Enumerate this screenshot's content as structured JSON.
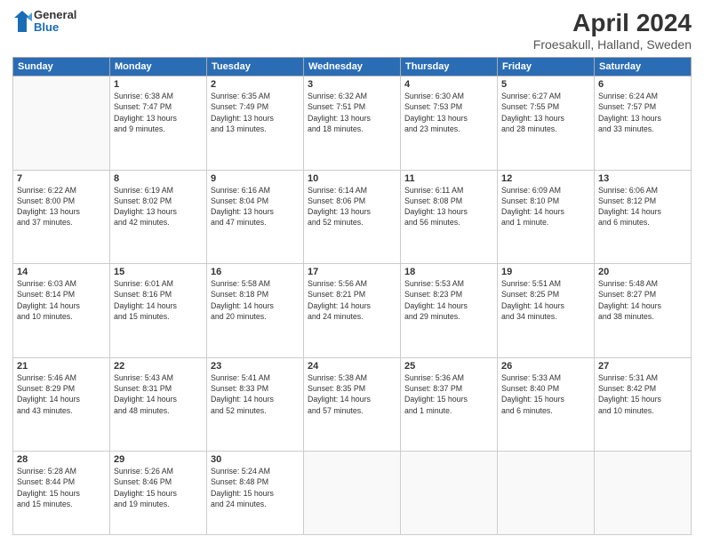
{
  "header": {
    "logo_general": "General",
    "logo_blue": "Blue",
    "title": "April 2024",
    "subtitle": "Froesakull, Halland, Sweden"
  },
  "days_of_week": [
    "Sunday",
    "Monday",
    "Tuesday",
    "Wednesday",
    "Thursday",
    "Friday",
    "Saturday"
  ],
  "weeks": [
    [
      {
        "day": "",
        "info": ""
      },
      {
        "day": "1",
        "info": "Sunrise: 6:38 AM\nSunset: 7:47 PM\nDaylight: 13 hours\nand 9 minutes."
      },
      {
        "day": "2",
        "info": "Sunrise: 6:35 AM\nSunset: 7:49 PM\nDaylight: 13 hours\nand 13 minutes."
      },
      {
        "day": "3",
        "info": "Sunrise: 6:32 AM\nSunset: 7:51 PM\nDaylight: 13 hours\nand 18 minutes."
      },
      {
        "day": "4",
        "info": "Sunrise: 6:30 AM\nSunset: 7:53 PM\nDaylight: 13 hours\nand 23 minutes."
      },
      {
        "day": "5",
        "info": "Sunrise: 6:27 AM\nSunset: 7:55 PM\nDaylight: 13 hours\nand 28 minutes."
      },
      {
        "day": "6",
        "info": "Sunrise: 6:24 AM\nSunset: 7:57 PM\nDaylight: 13 hours\nand 33 minutes."
      }
    ],
    [
      {
        "day": "7",
        "info": "Sunrise: 6:22 AM\nSunset: 8:00 PM\nDaylight: 13 hours\nand 37 minutes."
      },
      {
        "day": "8",
        "info": "Sunrise: 6:19 AM\nSunset: 8:02 PM\nDaylight: 13 hours\nand 42 minutes."
      },
      {
        "day": "9",
        "info": "Sunrise: 6:16 AM\nSunset: 8:04 PM\nDaylight: 13 hours\nand 47 minutes."
      },
      {
        "day": "10",
        "info": "Sunrise: 6:14 AM\nSunset: 8:06 PM\nDaylight: 13 hours\nand 52 minutes."
      },
      {
        "day": "11",
        "info": "Sunrise: 6:11 AM\nSunset: 8:08 PM\nDaylight: 13 hours\nand 56 minutes."
      },
      {
        "day": "12",
        "info": "Sunrise: 6:09 AM\nSunset: 8:10 PM\nDaylight: 14 hours\nand 1 minute."
      },
      {
        "day": "13",
        "info": "Sunrise: 6:06 AM\nSunset: 8:12 PM\nDaylight: 14 hours\nand 6 minutes."
      }
    ],
    [
      {
        "day": "14",
        "info": "Sunrise: 6:03 AM\nSunset: 8:14 PM\nDaylight: 14 hours\nand 10 minutes."
      },
      {
        "day": "15",
        "info": "Sunrise: 6:01 AM\nSunset: 8:16 PM\nDaylight: 14 hours\nand 15 minutes."
      },
      {
        "day": "16",
        "info": "Sunrise: 5:58 AM\nSunset: 8:18 PM\nDaylight: 14 hours\nand 20 minutes."
      },
      {
        "day": "17",
        "info": "Sunrise: 5:56 AM\nSunset: 8:21 PM\nDaylight: 14 hours\nand 24 minutes."
      },
      {
        "day": "18",
        "info": "Sunrise: 5:53 AM\nSunset: 8:23 PM\nDaylight: 14 hours\nand 29 minutes."
      },
      {
        "day": "19",
        "info": "Sunrise: 5:51 AM\nSunset: 8:25 PM\nDaylight: 14 hours\nand 34 minutes."
      },
      {
        "day": "20",
        "info": "Sunrise: 5:48 AM\nSunset: 8:27 PM\nDaylight: 14 hours\nand 38 minutes."
      }
    ],
    [
      {
        "day": "21",
        "info": "Sunrise: 5:46 AM\nSunset: 8:29 PM\nDaylight: 14 hours\nand 43 minutes."
      },
      {
        "day": "22",
        "info": "Sunrise: 5:43 AM\nSunset: 8:31 PM\nDaylight: 14 hours\nand 48 minutes."
      },
      {
        "day": "23",
        "info": "Sunrise: 5:41 AM\nSunset: 8:33 PM\nDaylight: 14 hours\nand 52 minutes."
      },
      {
        "day": "24",
        "info": "Sunrise: 5:38 AM\nSunset: 8:35 PM\nDaylight: 14 hours\nand 57 minutes."
      },
      {
        "day": "25",
        "info": "Sunrise: 5:36 AM\nSunset: 8:37 PM\nDaylight: 15 hours\nand 1 minute."
      },
      {
        "day": "26",
        "info": "Sunrise: 5:33 AM\nSunset: 8:40 PM\nDaylight: 15 hours\nand 6 minutes."
      },
      {
        "day": "27",
        "info": "Sunrise: 5:31 AM\nSunset: 8:42 PM\nDaylight: 15 hours\nand 10 minutes."
      }
    ],
    [
      {
        "day": "28",
        "info": "Sunrise: 5:28 AM\nSunset: 8:44 PM\nDaylight: 15 hours\nand 15 minutes."
      },
      {
        "day": "29",
        "info": "Sunrise: 5:26 AM\nSunset: 8:46 PM\nDaylight: 15 hours\nand 19 minutes."
      },
      {
        "day": "30",
        "info": "Sunrise: 5:24 AM\nSunset: 8:48 PM\nDaylight: 15 hours\nand 24 minutes."
      },
      {
        "day": "",
        "info": ""
      },
      {
        "day": "",
        "info": ""
      },
      {
        "day": "",
        "info": ""
      },
      {
        "day": "",
        "info": ""
      }
    ]
  ]
}
